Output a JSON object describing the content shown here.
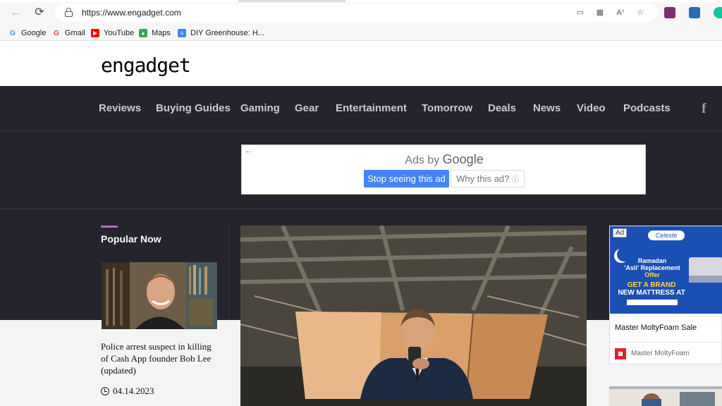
{
  "browser": {
    "url": "https://www.engadget.com",
    "bookmarks": [
      {
        "label": "Google",
        "icon": "google-icon",
        "color": "#4285f4"
      },
      {
        "label": "Gmail",
        "icon": "gmail-icon",
        "color": "#ea4335"
      },
      {
        "label": "YouTube",
        "icon": "youtube-icon",
        "color": "#ff0000"
      },
      {
        "label": "Maps",
        "icon": "maps-icon",
        "color": "#34a853"
      },
      {
        "label": "DIY Greenhouse: H...",
        "icon": "docs-icon",
        "color": "#4285f4"
      }
    ]
  },
  "site": {
    "logo": "engadget",
    "nav": [
      "Reviews",
      "Buying Guides",
      "Gaming",
      "Gear",
      "Entertainment",
      "Tomorrow",
      "Deals",
      "News",
      "Video",
      "Podcasts"
    ],
    "social_icon": "facebook-icon"
  },
  "top_ad": {
    "ads_by": "Ads by",
    "google": "Google",
    "stop_label": "Stop seeing this ad",
    "why_label": "Why this ad?"
  },
  "popular": {
    "heading": "Popular Now",
    "story_title": "Police arrest suspect in killing of Cash App founder Bob Lee (updated)",
    "date": "04.14.2023"
  },
  "side_ad": {
    "tag": "Ad",
    "brand_badge": "Celeste",
    "headline_1": "Ramadan",
    "headline_2": "'Asli' Replacement",
    "headline_3": "Offer",
    "headline_4": "GET A BRAND",
    "headline_5": "NEW MATTRESS AT",
    "title": "Master MoltyFoam Sale",
    "source": "Master MoltyFoam"
  },
  "colors": {
    "dark_bg": "#24242c",
    "accent": "#b36cc7",
    "ad_button": "#4285f4"
  }
}
